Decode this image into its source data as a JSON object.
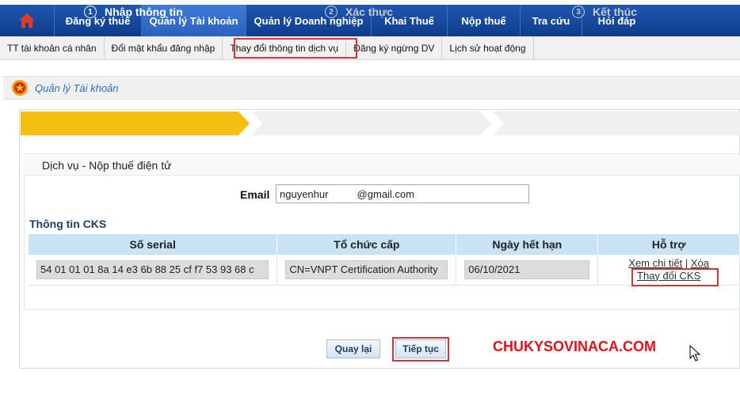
{
  "topnav": {
    "home_icon": "home-icon",
    "items": [
      {
        "label": "Đăng ký thuế"
      },
      {
        "label": "Quản lý Tài khoản",
        "active": true
      },
      {
        "label": "Quản lý Doanh nghiệp"
      },
      {
        "label": "Khai Thuế"
      },
      {
        "label": "Nộp thuế"
      },
      {
        "label": "Tra cứu"
      },
      {
        "label": "Hỏi đáp"
      }
    ]
  },
  "subnav": {
    "items": [
      {
        "label": "TT tài khoản cá nhân"
      },
      {
        "label": "Đổi mật khẩu đăng nhập"
      },
      {
        "label": "Thay đổi thông tin dịch vụ",
        "highlighted": true
      },
      {
        "label": "Đăng ký ngừng DV"
      },
      {
        "label": "Lịch sử hoạt động"
      }
    ]
  },
  "breadcrumb": {
    "icon": "emblem-icon",
    "label": "Quản lý Tài khoản"
  },
  "steps": [
    {
      "number": "1",
      "label": "Nhập thông tin",
      "active": true
    },
    {
      "number": "2",
      "label": "Xác thực",
      "active": false
    },
    {
      "number": "3",
      "label": "Kết thúc",
      "active": false
    }
  ],
  "form": {
    "section_title": "Dịch vụ - Nộp thuế điện tử",
    "email_label": "Email",
    "email_value": "nguyenhur          @gmail.com"
  },
  "cks": {
    "title": "Thông tin CKS",
    "columns": [
      "Số serial",
      "Tổ chức cấp",
      "Ngày hết hạn",
      "Hỗ trợ"
    ],
    "row": {
      "serial": "54 01 01 01 8a 14 e3 6b 88 25 cf f7 53 93 68 c",
      "issuer": "CN=VNPT Certification Authority",
      "expiry": "06/10/2021",
      "link_view": "Xem chi tiết",
      "separator": "|",
      "link_delete": "Xóa",
      "link_change": "Thay đổi CKS"
    }
  },
  "buttons": {
    "back": "Quay lại",
    "next": "Tiếp tục"
  },
  "watermark": "CHUKYSOVINACA.COM",
  "colors": {
    "nav_bg": "#0f3d8a",
    "step_active": "#f5bf12",
    "highlight_red": "#d9343a",
    "table_header": "#c7e3f5",
    "watermark": "#e1121b"
  }
}
